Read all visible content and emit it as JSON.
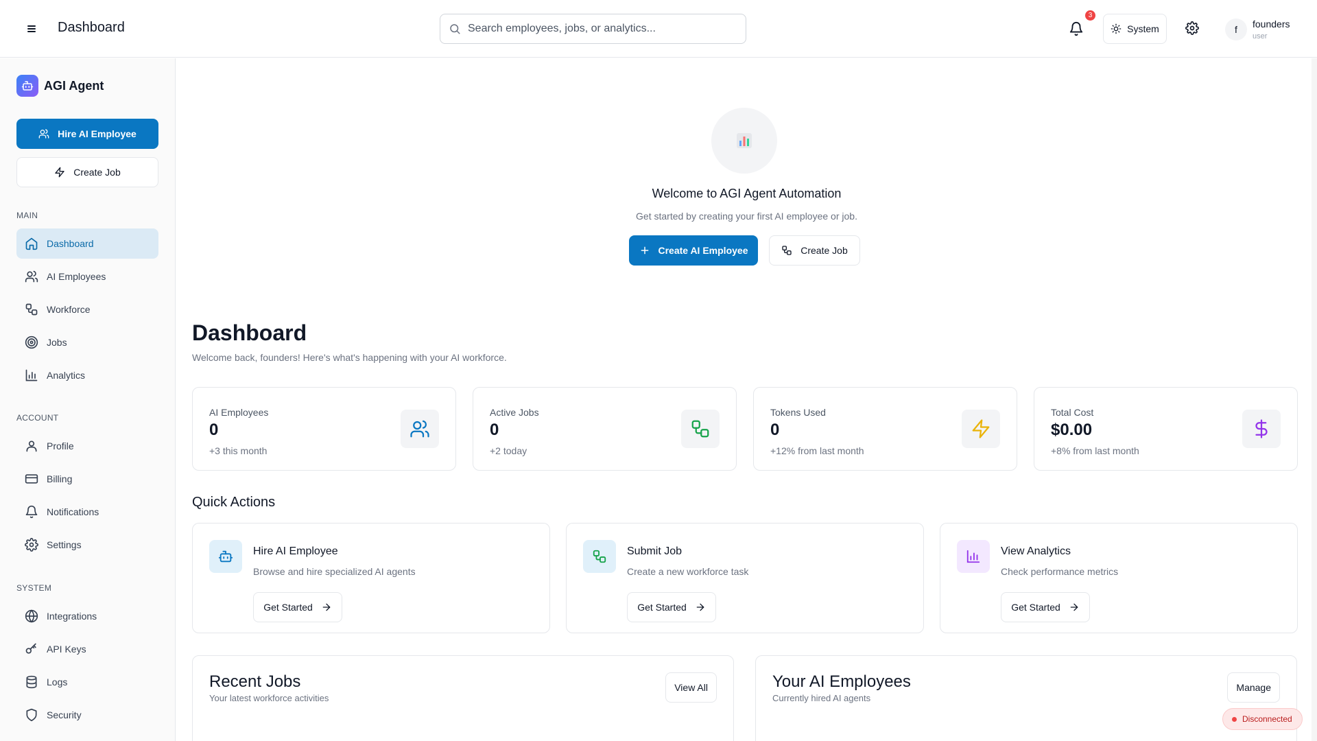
{
  "header": {
    "title": "Dashboard",
    "search_placeholder": "Search employees, jobs, or analytics...",
    "notification_count": "3",
    "theme_label": "System",
    "user_initial": "f",
    "user_name": "founders",
    "user_role": "user"
  },
  "sidebar": {
    "brand": "AGI Agent",
    "primary_button": "Hire AI Employee",
    "secondary_button": "Create Job",
    "sections": {
      "main": "MAIN",
      "account": "ACCOUNT",
      "system": "SYSTEM"
    },
    "items": [
      {
        "label": "Dashboard",
        "icon": "home-icon",
        "active": true
      },
      {
        "label": "AI Employees",
        "icon": "users-icon"
      },
      {
        "label": "Workforce",
        "icon": "workflow-icon"
      },
      {
        "label": "Jobs",
        "icon": "target-icon"
      },
      {
        "label": "Analytics",
        "icon": "bar-chart-icon"
      },
      {
        "label": "Profile",
        "icon": "user-icon"
      },
      {
        "label": "Billing",
        "icon": "credit-card-icon"
      },
      {
        "label": "Notifications",
        "icon": "bell-icon"
      },
      {
        "label": "Settings",
        "icon": "gear-icon"
      },
      {
        "label": "Integrations",
        "icon": "globe-icon"
      },
      {
        "label": "API Keys",
        "icon": "key-icon"
      },
      {
        "label": "Logs",
        "icon": "database-icon"
      },
      {
        "label": "Security",
        "icon": "shield-icon"
      }
    ]
  },
  "welcome": {
    "title": "Welcome to AGI Agent Automation",
    "subtitle": "Get started by creating your first AI employee or job.",
    "primary_button": "Create AI Employee",
    "secondary_button": "Create Job"
  },
  "dashboard": {
    "title": "Dashboard",
    "subtitle": "Welcome back, founders! Here's what's happening with your AI workforce."
  },
  "stats": [
    {
      "label": "AI Employees",
      "value": "0",
      "note": "+3 this month",
      "icon": "users-icon",
      "color": "#0a77c2"
    },
    {
      "label": "Active Jobs",
      "value": "0",
      "note": "+2 today",
      "icon": "workflow-icon",
      "color": "#16a34a"
    },
    {
      "label": "Tokens Used",
      "value": "0",
      "note": "+12% from last month",
      "icon": "zap-icon",
      "color": "#eab308"
    },
    {
      "label": "Total Cost",
      "value": "$0.00",
      "note": "+8% from last month",
      "icon": "dollar-icon",
      "color": "#9333ea"
    }
  ],
  "quick_actions": {
    "title": "Quick Actions",
    "items": [
      {
        "title": "Hire AI Employee",
        "desc": "Browse and hire specialized AI agents",
        "button": "Get Started",
        "icon": "bot-icon",
        "color": "#0a77c2"
      },
      {
        "title": "Submit Job",
        "desc": "Create a new workforce task",
        "button": "Get Started",
        "icon": "workflow-icon",
        "color": "#16a34a"
      },
      {
        "title": "View Analytics",
        "desc": "Check performance metrics",
        "button": "Get Started",
        "icon": "bar-chart-icon",
        "color": "#9333ea"
      }
    ]
  },
  "recent_jobs": {
    "title": "Recent Jobs",
    "subtitle": "Your latest workforce activities",
    "button": "View All"
  },
  "your_employees": {
    "title": "Your AI Employees",
    "subtitle": "Currently hired AI agents",
    "button": "Manage"
  },
  "connection": {
    "status": "Disconnected",
    "color": "#ef4444"
  },
  "colors": {
    "accent": "#0a77c2",
    "active_bg": "#dbeaf5"
  }
}
